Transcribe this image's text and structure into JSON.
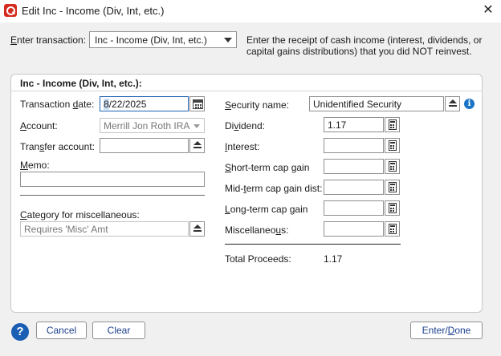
{
  "window": {
    "title": "Edit Inc - Income (Div, Int, etc.)",
    "close_symbol": "✕"
  },
  "transaction": {
    "label_prefix": "",
    "label_accel": "E",
    "label_rest": "nter transaction:",
    "selected": "Inc - Income (Div, Int, etc.)",
    "description": "Enter the receipt of cash income (interest, dividends, or capital gains distributions) that you did NOT reinvest."
  },
  "panel": {
    "title": "Inc - Income (Div, Int, etc.):"
  },
  "left": {
    "date": {
      "pre": "Transaction ",
      "accel": "d",
      "post": "ate:",
      "value_selected": "8",
      "value_rest": "/22/2025"
    },
    "account": {
      "pre": "",
      "accel": "A",
      "post": "ccount:",
      "value": "Merrill Jon Roth IRA"
    },
    "transfer": {
      "pre": "Tran",
      "accel": "s",
      "post": "fer account:",
      "value": ""
    },
    "memo": {
      "pre": "",
      "accel": "M",
      "post": "emo:",
      "value": ""
    },
    "category": {
      "pre": "",
      "accel": "C",
      "post": "ategory for miscellaneous:",
      "placeholder": "Requires 'Misc' Amt"
    }
  },
  "right": {
    "security": {
      "pre": "",
      "accel": "S",
      "post": "ecurity name:",
      "value": "Unidentified Security"
    },
    "dividend": {
      "pre": "Di",
      "accel": "v",
      "post": "idend:",
      "value": "1.17"
    },
    "interest": {
      "pre": "",
      "accel": "I",
      "post": "nterest:",
      "value": ""
    },
    "short_term": {
      "pre": "",
      "accel": "S",
      "post": "hort-term cap gain",
      "value": ""
    },
    "mid_term": {
      "pre": "Mid-",
      "accel": "t",
      "post": "erm cap gain dist:",
      "value": ""
    },
    "long_term": {
      "pre": "",
      "accel": "L",
      "post": "ong-term cap gain",
      "value": ""
    },
    "misc": {
      "pre": "Miscellaneo",
      "accel": "u",
      "post": "s:",
      "value": ""
    },
    "total_label": "Total Proceeds:",
    "total_value": "1.17"
  },
  "footer": {
    "help_symbol": "?",
    "cancel": "Cancel",
    "clear": "Clear",
    "enter_done_pre": "Enter/",
    "enter_done_accel": "D",
    "enter_done_post": "one"
  },
  "colors": {
    "accent": "#1a5fb4",
    "brand_logo": "#d52b1e",
    "info": "#1a73c7"
  }
}
